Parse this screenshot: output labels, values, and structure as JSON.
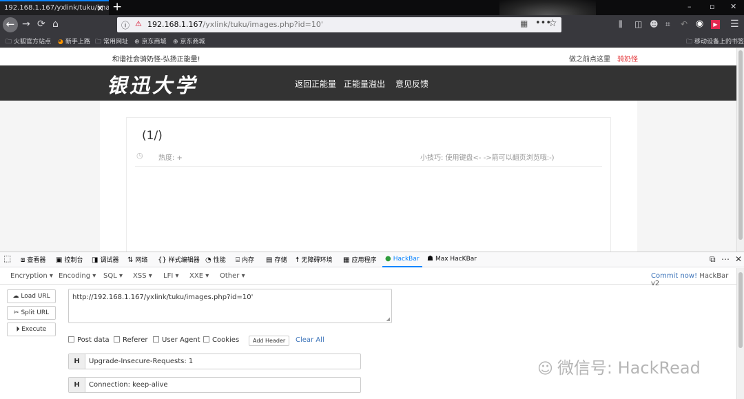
{
  "browser": {
    "tab_title": "192.168.1.167/yxlink/tuku/imag",
    "tab_close": "×",
    "new_tab": "+",
    "url": {
      "host": "192.168.1.167",
      "path": "/yxlink/tuku/images.php?id=10'"
    },
    "window_controls": [
      "–",
      "▫",
      "✕"
    ],
    "nav_icons": {
      "back": "←",
      "forward": "→",
      "reload": "⟳",
      "home": "⌂",
      "menu": "☰"
    },
    "bookmarks": [
      {
        "icon": "folder-icon",
        "label": "火狐官方站点"
      },
      {
        "icon": "firefox-icon",
        "label": "新手上路"
      },
      {
        "icon": "folder-icon",
        "label": "常用网址"
      },
      {
        "icon": "globe-icon",
        "label": "京东商城"
      },
      {
        "icon": "globe-icon",
        "label": "京东商城"
      }
    ],
    "mobile_bookmarks": "移动设备上的书签"
  },
  "page": {
    "slogan": "和谐社会骑奶怪-弘扬正能量!",
    "top_right_link": "做之前点这里",
    "top_right_user": "骑奶怪",
    "brand": "银迅大学",
    "nav": [
      "返回正能量",
      "正能量溢出",
      "意见反馈"
    ],
    "card_title": "(1/)",
    "heat_label": "热度: +",
    "tip": "小技巧: 使用键盘<- ->箭可以翻页浏览哦:-)"
  },
  "devtools": {
    "tabs": [
      {
        "icon": "inspector-icon",
        "glyph": "⧈",
        "label": "查看器"
      },
      {
        "icon": "console-icon",
        "glyph": "▣",
        "label": "控制台"
      },
      {
        "icon": "debugger-icon",
        "glyph": "◨",
        "label": "调试器"
      },
      {
        "icon": "network-icon",
        "glyph": "⇅",
        "label": "网络"
      },
      {
        "icon": "style-editor-icon",
        "glyph": "{}",
        "label": "样式编辑器"
      },
      {
        "icon": "performance-icon",
        "glyph": "◔",
        "label": "性能"
      },
      {
        "icon": "memory-icon",
        "glyph": "⌸",
        "label": "内存"
      },
      {
        "icon": "storage-icon",
        "glyph": "▤",
        "label": "存储"
      },
      {
        "icon": "accessibility-icon",
        "glyph": "☨",
        "label": "无障碍环境"
      },
      {
        "icon": "application-icon",
        "glyph": "▦",
        "label": "应用程序"
      },
      {
        "icon": "hackbar-icon",
        "glyph": "●",
        "label": "HackBar"
      },
      {
        "icon": "max-hackbar-icon",
        "glyph": "☗",
        "label": "Max HacKBar"
      }
    ],
    "active_tab": "HackBar"
  },
  "hackbar": {
    "menu": [
      "Encoding ▾",
      "Encoding ▾",
      "SQL ▾",
      "XSS ▾",
      "LFI ▾",
      "XXE ▾",
      "Other ▾"
    ],
    "commit": "Commit now!",
    "version": "HackBar v2",
    "buttons": {
      "load": "Load URL",
      "split": "Split URL",
      "execute": "Execute"
    },
    "url_value": "http://192.168.1.167/yxlink/tuku/images.php?id=10'",
    "options": [
      "Post data",
      "Referer",
      "User Agent",
      "Cookies"
    ],
    "add_header": "Add Header",
    "clear_all": "Clear All",
    "headers": [
      {
        "tag": "H",
        "value": "Upgrade-Insecure-Requests: 1"
      },
      {
        "tag": "H",
        "value": "Connection: keep-alive"
      }
    ]
  },
  "watermark": "微信号: HackRead",
  "colors": {
    "accent": "#0a84ff",
    "link": "#3b73b9",
    "nav_dark": "#333333",
    "user_red": "#e4393c"
  }
}
